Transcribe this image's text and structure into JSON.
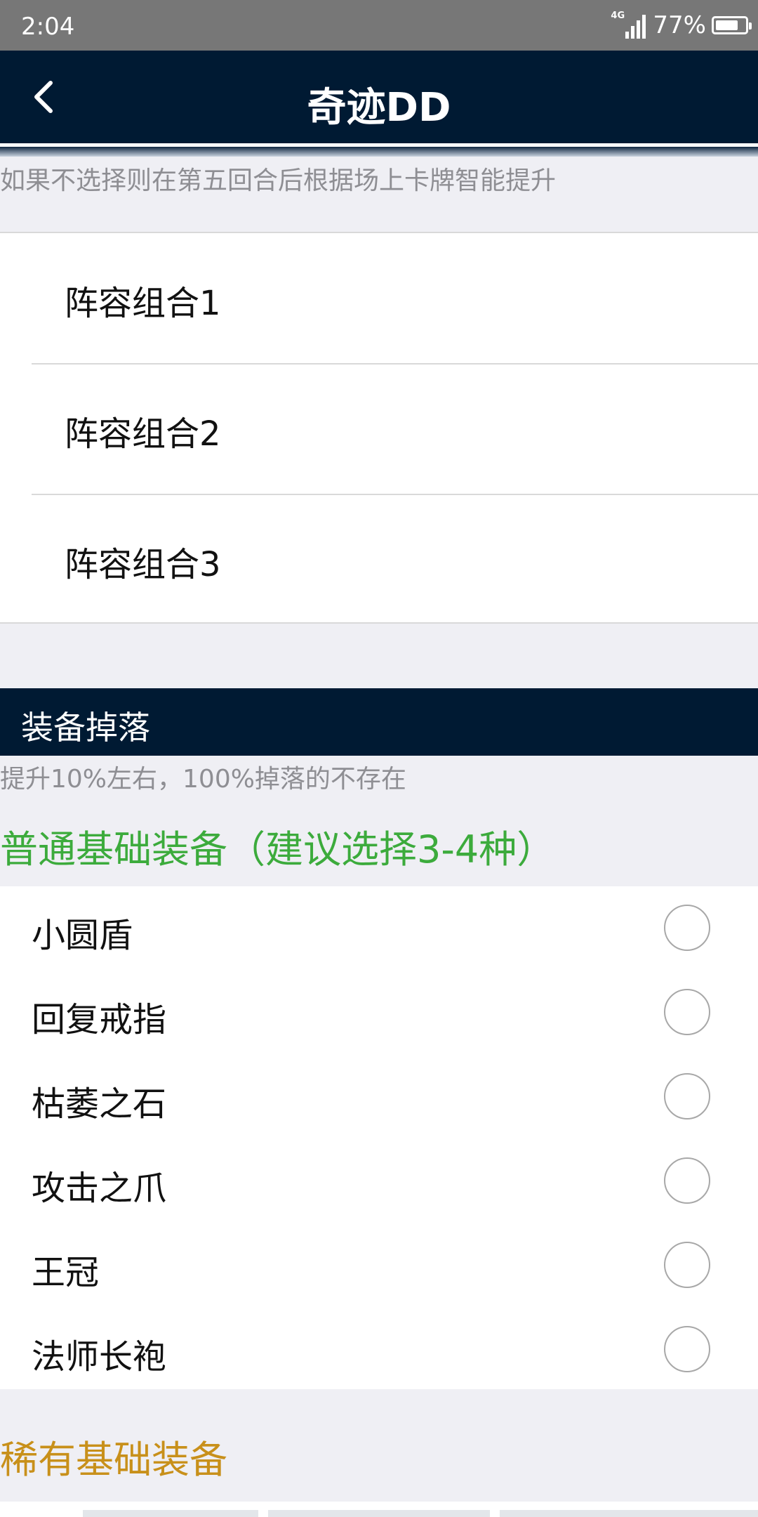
{
  "status_bar": {
    "time": "2:04",
    "network": "4G",
    "battery": "77%",
    "battery_level": 0.77
  },
  "app_bar": {
    "title": "奇迹DD",
    "back_icon": "chevron-left-icon"
  },
  "lineup": {
    "hint": "如果不选择则在第五回合后根据场上卡牌智能提升",
    "items": [
      {
        "label": "阵容组合1"
      },
      {
        "label": "阵容组合2"
      },
      {
        "label": "阵容组合3"
      }
    ]
  },
  "equipment": {
    "section_title": "装备掉落",
    "hint": "提升10%左右，100%掉落的不存在",
    "basic_title": "普通基础装备（建议选择3-4种）",
    "basic_items": [
      {
        "label": "小圆盾",
        "selected": false
      },
      {
        "label": "回复戒指",
        "selected": false
      },
      {
        "label": "枯萎之石",
        "selected": false
      },
      {
        "label": "攻击之爪",
        "selected": false
      },
      {
        "label": "王冠",
        "selected": false
      },
      {
        "label": "法师长袍",
        "selected": false
      }
    ],
    "rare_title": "稀有基础装备"
  },
  "colors": {
    "navy": "#001a33",
    "green": "#3cab3c",
    "gold": "#c8901a",
    "background": "#efeff4"
  }
}
